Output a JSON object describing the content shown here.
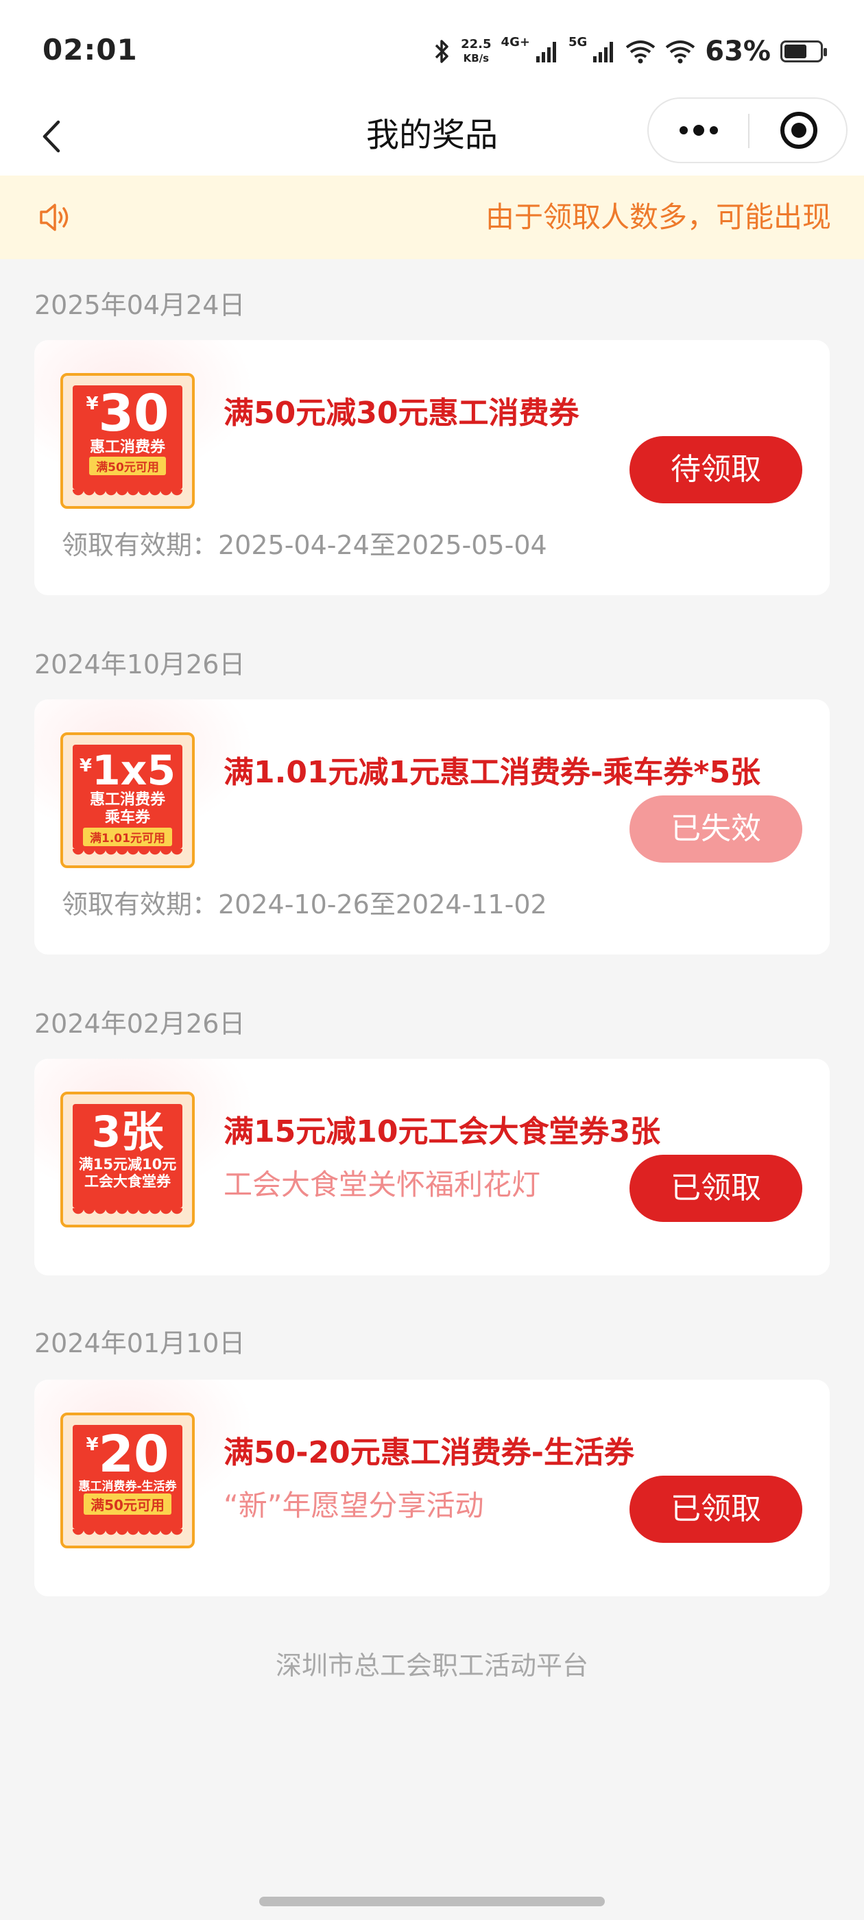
{
  "status_bar": {
    "time": "02:01",
    "net_speed_value": "22.5",
    "net_speed_unit": "KB/s",
    "signal1_label": "4G+",
    "signal2_label": "5G",
    "battery_percent": "63%",
    "battery_level": 0.63
  },
  "nav": {
    "title": "我的奖品"
  },
  "notice": {
    "text": "由于领取人数多，可能出现"
  },
  "prizes": [
    {
      "date": "2025年04月24日",
      "coupon": {
        "yen": "¥",
        "big": "30",
        "line1": "惠工消费券",
        "line2": "",
        "strip": "满50元可用"
      },
      "title": "满50元减30元惠工消费券",
      "subtitle": "",
      "validity": "领取有效期：2025-04-24至2025-05-04",
      "status": "待领取",
      "status_state": "active"
    },
    {
      "date": "2024年10月26日",
      "coupon": {
        "yen": "¥",
        "big": "1x5",
        "line1": "惠工消费券",
        "line2": "乘车券",
        "strip": "满1.01元可用"
      },
      "title": "满1.01元减1元惠工消费券-乘车券*5张",
      "subtitle": "",
      "validity": "领取有效期：2024-10-26至2024-11-02",
      "status": "已失效",
      "status_state": "expired"
    },
    {
      "date": "2024年02月26日",
      "coupon": {
        "yen": "",
        "big": "3张",
        "line1": "满15元减10元",
        "line2": "工会大食堂券",
        "strip": ""
      },
      "title": "满15元减10元工会大食堂券3张",
      "subtitle": "工会大食堂关怀福利花灯",
      "validity": "",
      "status": "已领取",
      "status_state": "claimed"
    },
    {
      "date": "2024年01月10日",
      "coupon": {
        "yen": "¥",
        "big": "20",
        "line1": "惠工消费券-生活券",
        "line2": "",
        "strip": "满50元可用"
      },
      "title": "满50-20元惠工消费券-生活券",
      "subtitle": "“新”年愿望分享活动",
      "validity": "",
      "status": "已领取",
      "status_state": "claimed"
    }
  ],
  "footer": {
    "text": "深圳市总工会职工活动平台"
  },
  "colors": {
    "accent_red": "#de2222",
    "title_red": "#d91f1f",
    "notice_orange": "#ee7a2c",
    "notice_bg": "#fff8e1"
  }
}
